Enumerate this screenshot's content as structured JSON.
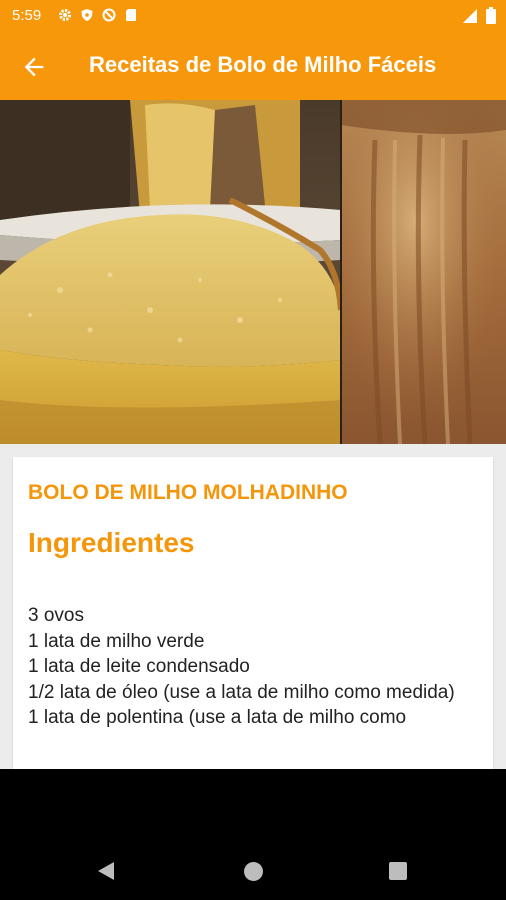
{
  "status_bar": {
    "time": "5:59",
    "background": "#f6980a",
    "icons_left": [
      "gear-icon",
      "shield-icon",
      "no-entry-icon",
      "sd-card-icon"
    ],
    "icons_right": [
      "signal-icon",
      "battery-icon"
    ]
  },
  "app_bar": {
    "title": "Receitas de Bolo de Milho Fáceis",
    "back_icon": "arrow-left-icon",
    "background": "#f7980c"
  },
  "recipe": {
    "name": "BOLO DE MILHO MOLHADINHO",
    "section_title": "Ingredientes",
    "ingredients": [
      "3 ovos",
      "1 lata de milho verde",
      "1 lata de leite condensado",
      "1/2 lata de óleo (use a lata de milho como medida)",
      "1 lata de polentina (use a lata de milho como"
    ],
    "accent_color": "#f5960a"
  },
  "nav_bar": {
    "icons": [
      "nav-back-icon",
      "nav-home-icon",
      "nav-recents-icon"
    ]
  }
}
